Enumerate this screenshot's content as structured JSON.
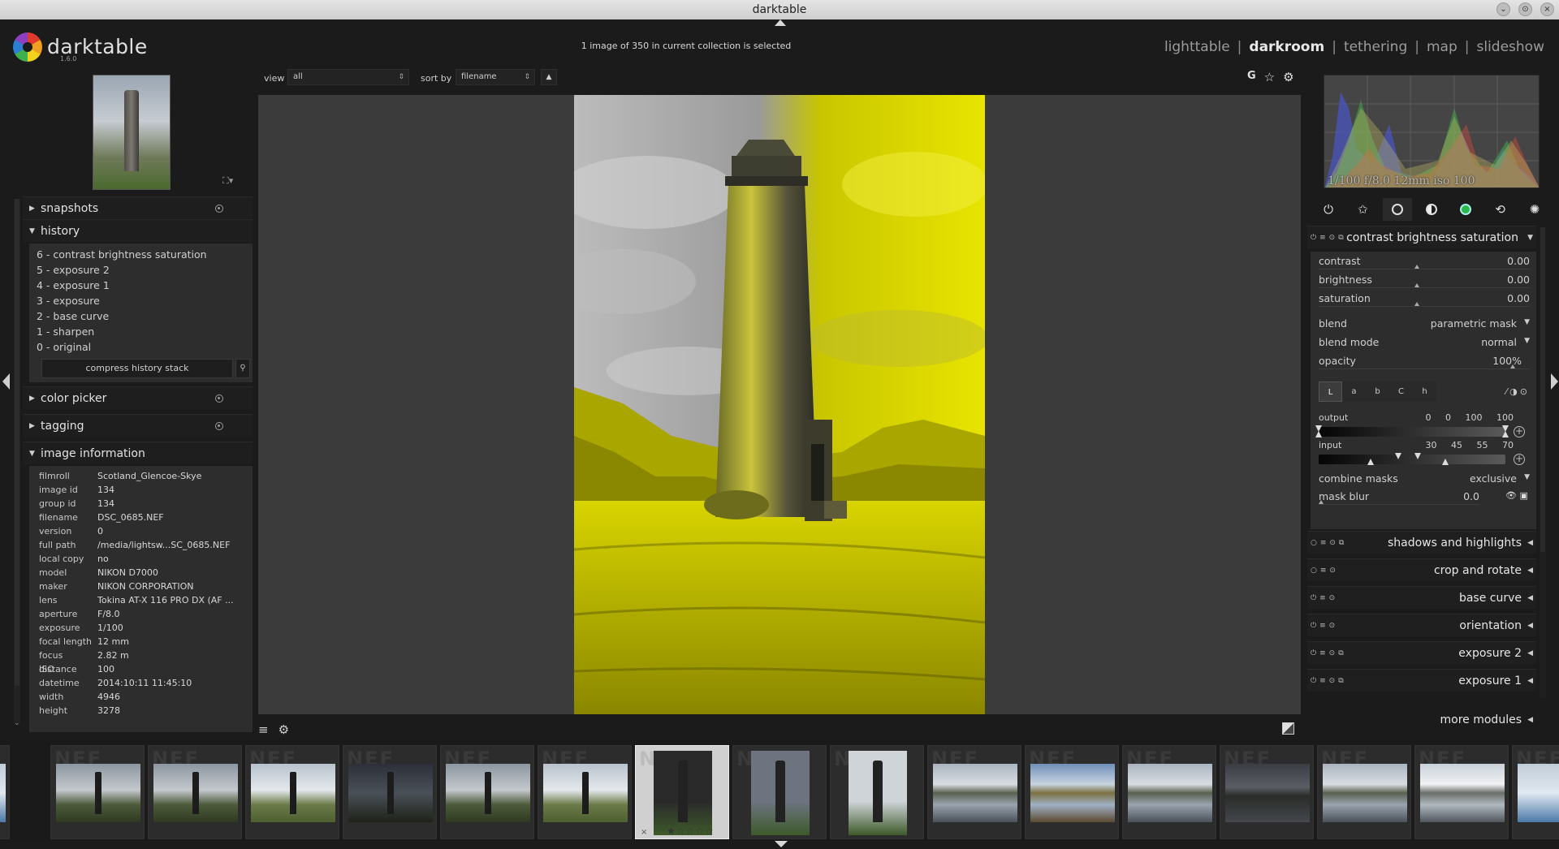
{
  "window": {
    "title": "darktable",
    "buttons": [
      "minimize",
      "maximize",
      "close"
    ]
  },
  "header": {
    "logo_text": "darktable",
    "version": "1.6.0",
    "collection_status": "1 image of 350 in current collection is selected",
    "views": [
      {
        "label": "lighttable",
        "active": false
      },
      {
        "label": "darkroom",
        "active": true
      },
      {
        "label": "tethering",
        "active": false
      },
      {
        "label": "map",
        "active": false
      },
      {
        "label": "slideshow",
        "active": false
      }
    ],
    "separator": "|"
  },
  "left_panel": {
    "sections": {
      "snapshots": "snapshots",
      "history": "history",
      "color_picker": "color picker",
      "tagging": "tagging",
      "image_information": "image information"
    },
    "history_items": [
      "6 - contrast brightness saturation",
      "5 - exposure 2",
      "4 - exposure 1",
      "3 - exposure",
      "2 - base curve",
      "1 - sharpen",
      "0 - original"
    ],
    "compress_button": "compress history stack",
    "image_info": [
      {
        "key": "filmroll",
        "value": "Scotland_Glencoe-Skye"
      },
      {
        "key": "image id",
        "value": "134"
      },
      {
        "key": "group id",
        "value": "134"
      },
      {
        "key": "filename",
        "value": "DSC_0685.NEF"
      },
      {
        "key": "version",
        "value": "0"
      },
      {
        "key": "full path",
        "value": "/media/lightsw...SC_0685.NEF"
      },
      {
        "key": "local copy",
        "value": "no"
      },
      {
        "key": "model",
        "value": "NIKON D7000"
      },
      {
        "key": "maker",
        "value": "NIKON CORPORATION"
      },
      {
        "key": "lens",
        "value": "Tokina AT-X 116 PRO DX (AF ..."
      },
      {
        "key": "aperture",
        "value": "F/8.0"
      },
      {
        "key": "exposure",
        "value": "1/100"
      },
      {
        "key": "focal length",
        "value": "12 mm"
      },
      {
        "key": "focus distance",
        "value": "2.82 m"
      },
      {
        "key": "ISO",
        "value": "100"
      },
      {
        "key": "datetime",
        "value": "2014:10:11 11:45:10"
      },
      {
        "key": "width",
        "value": "4946"
      },
      {
        "key": "height",
        "value": "3278"
      }
    ]
  },
  "center": {
    "view_label": "view",
    "view_value": "all",
    "sort_label": "sort by",
    "sort_value": "filename",
    "sort_dir_icon": "▲",
    "top_icons": [
      "G",
      "☆",
      "⚙"
    ]
  },
  "right_panel": {
    "histogram_info": "1/100 f/8.0 12mm iso 100",
    "group_tabs": [
      "power-icon",
      "favorites-icon",
      "basic-group-icon",
      "tone-group-icon",
      "color-group-icon",
      "correct-group-icon",
      "effect-group-icon"
    ],
    "expanded_module": {
      "name": "contrast brightness saturation",
      "sliders": [
        {
          "label": "contrast",
          "value": "0.00"
        },
        {
          "label": "brightness",
          "value": "0.00"
        },
        {
          "label": "saturation",
          "value": "0.00"
        }
      ],
      "blend_label": "blend",
      "blend_value": "parametric mask",
      "blend_mode_label": "blend mode",
      "blend_mode_value": "normal",
      "opacity_label": "opacity",
      "opacity_value": "100%",
      "channels": [
        "L",
        "a",
        "b",
        "C",
        "h"
      ],
      "output_label": "output",
      "output_values": [
        "0",
        "0",
        "100",
        "100"
      ],
      "input_label": "input",
      "input_values": [
        "30",
        "45",
        "55",
        "70"
      ],
      "combine_label": "combine masks",
      "combine_value": "exclusive",
      "mask_blur_label": "mask blur",
      "mask_blur_value": "0.0"
    },
    "modules": [
      "shadows and highlights",
      "crop and rotate",
      "base curve",
      "orientation",
      "exposure 2",
      "exposure 1"
    ],
    "more_modules": "more modules"
  },
  "filmstrip": {
    "watermark": "NEF",
    "current_index": 7,
    "rating_stars": "★☆☆☆☆"
  },
  "colors": {
    "background": "#1b1b1b",
    "panel": "#2d2d2d",
    "canvas": "#3b3b3b",
    "accent_yellow": "#e8e400"
  }
}
